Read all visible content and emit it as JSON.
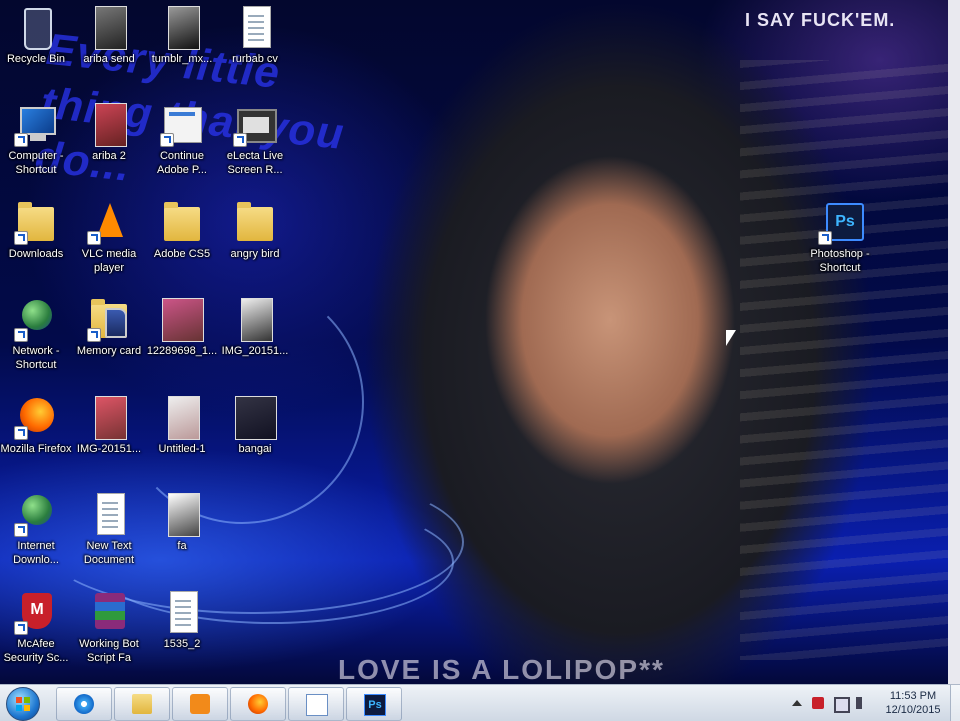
{
  "wallpaper": {
    "text_top": "I SAY FUCK'EM.",
    "text_left": "Every little thing that you do...",
    "text_bottom": "LOVE IS A LOLIPOP**"
  },
  "desktop_icons": [
    {
      "label": "Recycle Bin",
      "icon": "recycle-bin-icon",
      "shortcut": false
    },
    {
      "label": "ariba send",
      "icon": "image-thumbnail-icon",
      "shortcut": false
    },
    {
      "label": "tumblr_mx...",
      "icon": "image-thumbnail-icon",
      "shortcut": false
    },
    {
      "label": "rurbab cv",
      "icon": "word-document-icon",
      "shortcut": false
    },
    {
      "label": "Computer - Shortcut",
      "icon": "computer-icon",
      "shortcut": true
    },
    {
      "label": "ariba 2",
      "icon": "image-thumbnail-icon",
      "shortcut": false
    },
    {
      "label": "Continue Adobe P...",
      "icon": "window-icon",
      "shortcut": true
    },
    {
      "label": "eLecta Live Screen R...",
      "icon": "film-icon",
      "shortcut": true
    },
    {
      "label": "Downloads",
      "icon": "folder-icon",
      "shortcut": true
    },
    {
      "label": "VLC media player",
      "icon": "vlc-cone-icon",
      "shortcut": true
    },
    {
      "label": "Adobe CS5",
      "icon": "folder-icon",
      "shortcut": false
    },
    {
      "label": "angry bird",
      "icon": "folder-icon",
      "shortcut": false
    },
    {
      "label": "Network - Shortcut",
      "icon": "network-globe-icon",
      "shortcut": true
    },
    {
      "label": "Memory card",
      "icon": "sd-card-icon",
      "shortcut": true
    },
    {
      "label": "12289698_1...",
      "icon": "image-thumbnail-icon",
      "shortcut": false
    },
    {
      "label": "IMG_20151...",
      "icon": "image-thumbnail-icon",
      "shortcut": false
    },
    {
      "label": "Mozilla Firefox",
      "icon": "firefox-icon",
      "shortcut": true
    },
    {
      "label": "IMG-20151...",
      "icon": "image-thumbnail-icon",
      "shortcut": false
    },
    {
      "label": "Untitled-1",
      "icon": "image-thumbnail-icon",
      "shortcut": false
    },
    {
      "label": "bangai",
      "icon": "image-thumbnail-icon",
      "shortcut": false
    },
    {
      "label": "Internet Downlo...",
      "icon": "idm-globe-icon",
      "shortcut": true
    },
    {
      "label": "New Text Document",
      "icon": "text-document-icon",
      "shortcut": false
    },
    {
      "label": "fa",
      "icon": "image-thumbnail-icon",
      "shortcut": false
    },
    {
      "label": "McAfee Security Sc...",
      "icon": "mcafee-shield-icon",
      "shortcut": true
    },
    {
      "label": "Working Bot Script Fa",
      "icon": "winrar-archive-icon",
      "shortcut": false
    },
    {
      "label": "1535_2",
      "icon": "text-document-icon",
      "shortcut": false
    },
    {
      "label": "Photoshop - Shortcut",
      "icon": "photoshop-icon",
      "shortcut": true
    }
  ],
  "taskbar": {
    "pinned": [
      {
        "name": "internet-explorer",
        "icon": "internet-explorer-icon"
      },
      {
        "name": "windows-explorer",
        "icon": "folder-icon"
      },
      {
        "name": "media-player",
        "icon": "media-player-icon"
      },
      {
        "name": "firefox",
        "icon": "firefox-icon"
      },
      {
        "name": "paint",
        "icon": "paint-icon"
      },
      {
        "name": "photoshop",
        "icon": "photoshop-icon",
        "glyph": "Ps"
      }
    ],
    "clock": {
      "time": "11:53 PM",
      "date": "12/10/2015"
    }
  },
  "glyphs": {
    "ps": "Ps",
    "mcafee": "M"
  }
}
